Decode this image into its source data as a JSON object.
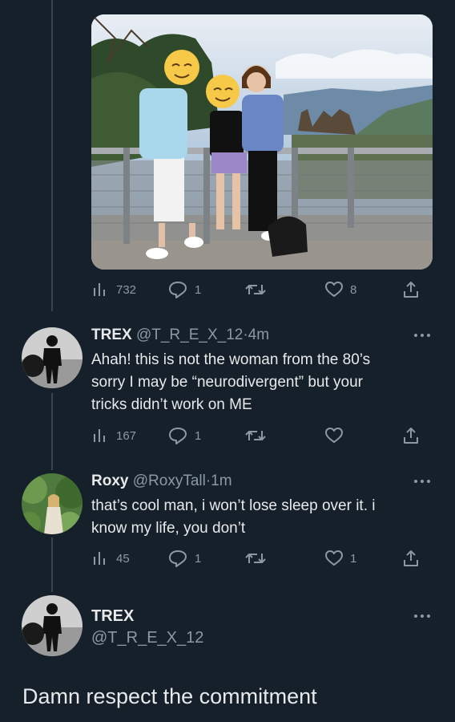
{
  "colors": {
    "background": "#15202b",
    "text": "#e7e9ea",
    "secondary": "#8b98a5",
    "thread_line": "#38444d"
  },
  "photo_post": {
    "icons": {
      "views": "bar-chart-icon",
      "replies": "reply-icon",
      "retweets": "retweet-icon",
      "likes": "heart-icon",
      "share": "share-icon"
    },
    "stats": {
      "views": "732",
      "replies": "1",
      "retweets": "",
      "likes": "8"
    }
  },
  "reply1": {
    "name": "TREX",
    "handle": "@T_R_E_X_12",
    "separator": "·",
    "time": "4m",
    "lines": [
      "Ahah! this is not the woman from the 80’s",
      "sorry I may be “neurodivergent” but your",
      "tricks didn’t work on ME"
    ],
    "stats": {
      "views": "167",
      "replies": "1",
      "retweets": "",
      "likes": ""
    }
  },
  "reply2": {
    "name": "Roxy",
    "handle": "@RoxyTall",
    "separator": "·",
    "time": "1m",
    "lines": [
      "that’s cool man, i won’t lose sleep over it. i",
      "know my life, you don’t"
    ],
    "stats": {
      "views": "45",
      "replies": "1",
      "retweets": "",
      "likes": "1"
    }
  },
  "focused": {
    "name": "TREX",
    "handle": "@T_R_E_X_12",
    "text": "Damn respect the commitment"
  }
}
